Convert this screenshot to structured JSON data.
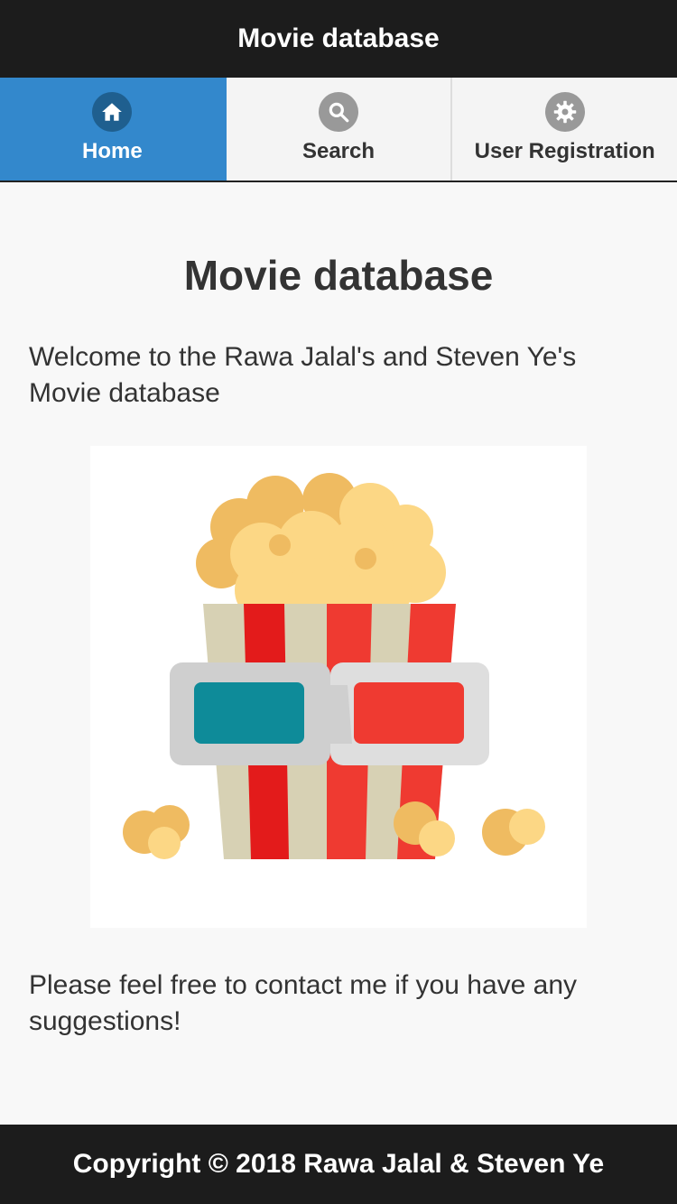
{
  "header": {
    "title": "Movie database"
  },
  "nav": {
    "tabs": [
      {
        "label": "Home",
        "icon": "home-icon",
        "active": true
      },
      {
        "label": "Search",
        "icon": "search-icon",
        "active": false
      },
      {
        "label": "User Registration",
        "icon": "gear-icon",
        "active": false
      }
    ]
  },
  "main": {
    "title": "Movie database",
    "welcome": "Welcome to the Rawa Jalal's and Steven Ye's Movie database",
    "image_icon": "popcorn-3d-glasses-illustration",
    "contact": "Please feel free to contact me if you have any suggestions!"
  },
  "footer": {
    "text": "Copyright © 2018 Rawa Jalal & Steven Ye"
  },
  "colors": {
    "header_bg": "#1c1c1c",
    "active_tab": "#3388cc",
    "page_bg": "#f8f8f8"
  }
}
